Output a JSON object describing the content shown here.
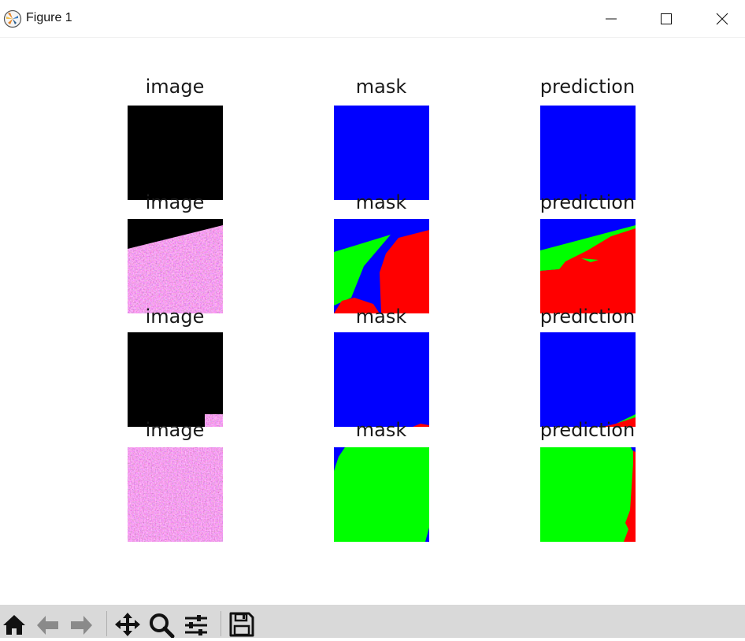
{
  "window": {
    "title": "Figure 1",
    "icon": "matplotlib-icon",
    "controls": [
      "minimize-icon",
      "maximize-icon",
      "close-icon"
    ]
  },
  "figure": {
    "column_titles": [
      "image",
      "mask",
      "prediction"
    ],
    "rows": [
      {
        "image": "black",
        "mask": "all-blue",
        "prediction": "all-blue"
      },
      {
        "image": "tissue-with-black-corner",
        "mask": "blue-green-red-segments",
        "prediction": "blue-green-over-red"
      },
      {
        "image": "black-with-tissue-corner",
        "mask": "blue-with-red-corner",
        "prediction": "blue-with-red-green-sliver"
      },
      {
        "image": "tissue",
        "mask": "green-with-blue-corner",
        "prediction": "green-with-red-right-edge"
      }
    ],
    "colors": {
      "class_blue": "#0000ff",
      "class_green": "#00ff00",
      "class_red": "#ff0000",
      "background": "#000000",
      "tissue": "#d63aa0"
    }
  },
  "toolbar": {
    "buttons": [
      "home-icon",
      "back-arrow-icon",
      "forward-arrow-icon",
      "pan-icon",
      "zoom-icon",
      "configure-subplots-icon",
      "save-icon"
    ]
  }
}
